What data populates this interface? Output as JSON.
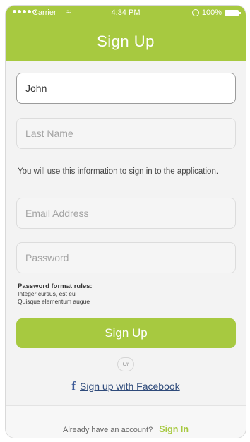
{
  "status_bar": {
    "carrier": "Carrier",
    "wifi_icon": "wifi-icon",
    "time": "4:34 PM",
    "battery": "100%",
    "battery_icon": "battery-icon"
  },
  "header": {
    "title": "Sign Up",
    "color": "#a7c940"
  },
  "form": {
    "first_name_value": "John",
    "last_name_placeholder": "Last Name",
    "info_text": "You will use this information to sign in to the application.",
    "email_placeholder": "Email Address",
    "password_placeholder": "Password",
    "password_rules": {
      "title": "Password format rules:",
      "lines": [
        "Integer cursus, est eu",
        "Quisque elementum augue"
      ]
    },
    "submit_label": "Sign Up"
  },
  "divider": {
    "label": "Or"
  },
  "facebook": {
    "icon": "facebook-icon",
    "label": "Sign up with Facebook"
  },
  "footer": {
    "prompt": "Already have an account?",
    "link": "Sign In"
  }
}
